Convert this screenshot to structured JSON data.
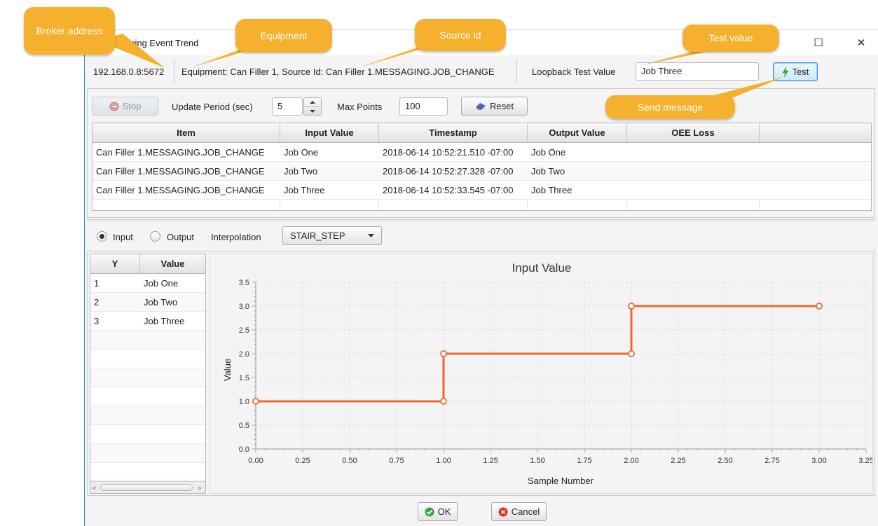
{
  "window": {
    "title": "aging Event Trend",
    "minimize": "—",
    "maximize": "☐",
    "close": "✕"
  },
  "topbar": {
    "broker_address": "192.168.0.8:5672",
    "source_info": "Equipment: Can Filler 1, Source Id: Can Filler 1.MESSAGING.JOB_CHANGE",
    "loopback_label": "Loopback Test Value",
    "loopback_value": "Job Three",
    "test_button": "Test"
  },
  "controls": {
    "stop_button": "Stop",
    "update_period_label": "Update Period (sec)",
    "update_period_value": "5",
    "max_points_label": "Max Points",
    "max_points_value": "100",
    "reset_button": "Reset"
  },
  "events_table": {
    "columns": [
      "Item",
      "Input Value",
      "Timestamp",
      "Output Value",
      "OEE Loss"
    ],
    "rows": [
      [
        "Can Filler 1.MESSAGING.JOB_CHANGE",
        "Job One",
        "2018-06-14 10:52:21.510 -07:00",
        "Job One",
        ""
      ],
      [
        "Can Filler 1.MESSAGING.JOB_CHANGE",
        "Job Two",
        "2018-06-14 10:52:27.328 -07:00",
        "Job Two",
        ""
      ],
      [
        "Can Filler 1.MESSAGING.JOB_CHANGE",
        "Job Three",
        "2018-06-14 10:52:33.545 -07:00",
        "Job Three",
        ""
      ]
    ]
  },
  "trend_options": {
    "input_label": "Input",
    "output_label": "Output",
    "selected": "Input",
    "interpolation_label": "Interpolation",
    "interpolation_value": "STAIR_STEP"
  },
  "mapping_table": {
    "columns": [
      "Y",
      "Value"
    ],
    "rows": [
      [
        "1",
        "Job One"
      ],
      [
        "2",
        "Job Two"
      ],
      [
        "3",
        "Job Three"
      ]
    ]
  },
  "chart_data": {
    "type": "line",
    "title": "Input Value",
    "xlabel": "Sample Number",
    "ylabel": "Value",
    "interpolation": "stair-step",
    "xlim": [
      0,
      3.25
    ],
    "ylim": [
      0,
      3.5
    ],
    "xticks": [
      "0.00",
      "0.25",
      "0.50",
      "0.75",
      "1.00",
      "1.25",
      "1.50",
      "1.75",
      "2.00",
      "2.25",
      "2.50",
      "2.75",
      "3.00",
      "3.25"
    ],
    "yticks": [
      "0.0",
      "0.5",
      "1.0",
      "1.5",
      "2.0",
      "2.5",
      "3.0",
      "3.5"
    ],
    "grid": true,
    "series_color": "#f26530",
    "points": [
      [
        0,
        1
      ],
      [
        1,
        1
      ],
      [
        1,
        2
      ],
      [
        2,
        2
      ],
      [
        2,
        3
      ],
      [
        3,
        3
      ]
    ]
  },
  "footer": {
    "ok_button": "OK",
    "cancel_button": "Cancel"
  },
  "callouts": {
    "broker": "Broker address",
    "equipment": "Equipment",
    "source_id": "Source id",
    "test_value": "Test value",
    "send_message": "Send message"
  },
  "colors": {
    "callout": "#f5b12e",
    "series": "#f26530",
    "window_accent": "#2a87c8"
  }
}
